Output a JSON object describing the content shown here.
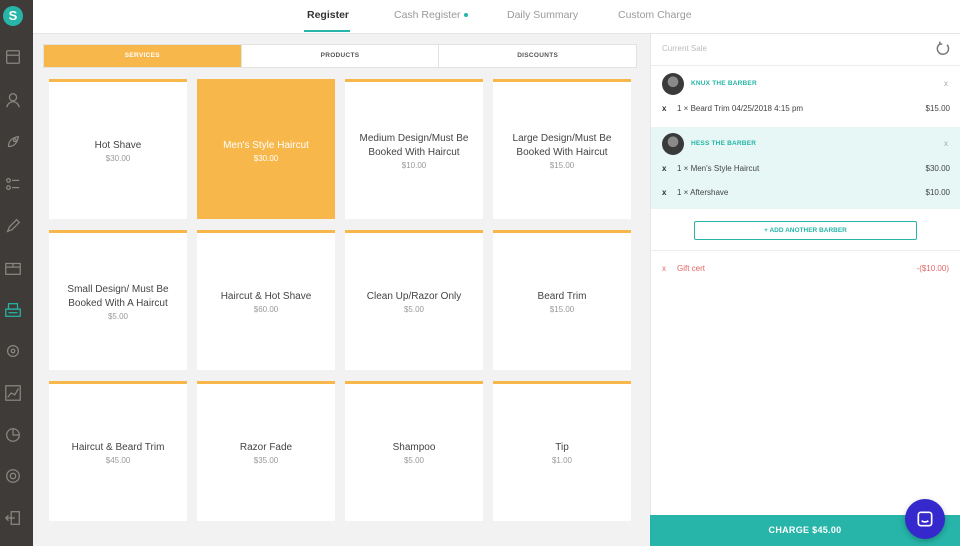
{
  "sidebar": {
    "logo": "S",
    "icons": [
      "register-icon",
      "customer-icon",
      "launch-icon",
      "list-icon",
      "edit-icon",
      "inventory-icon",
      "cash-register-icon",
      "settings-icon",
      "reports-icon",
      "analytics-icon",
      "support-icon",
      "logout-icon"
    ]
  },
  "topnav": {
    "tabs": [
      {
        "label": "Register",
        "active": true
      },
      {
        "label": "Cash Register",
        "active": false,
        "indicator": true
      },
      {
        "label": "Daily Summary",
        "active": false
      },
      {
        "label": "Custom Charge",
        "active": false
      }
    ]
  },
  "segments": [
    {
      "label": "SERVICES",
      "active": true
    },
    {
      "label": "PRODUCTS",
      "active": false
    },
    {
      "label": "DISCOUNTS",
      "active": false
    }
  ],
  "services": [
    {
      "name": "Hot Shave",
      "price": "$30.00",
      "selected": false
    },
    {
      "name": "Men's Style Haircut",
      "price": "$30.00",
      "selected": true
    },
    {
      "name": "Medium Design/Must Be Booked With Haircut",
      "price": "$10.00",
      "selected": false
    },
    {
      "name": "Large Design/Must Be Booked With Haircut",
      "price": "$15.00",
      "selected": false
    },
    {
      "name": "Small Design/ Must Be Booked With A Haircut",
      "price": "$5.00",
      "selected": false
    },
    {
      "name": "Haircut & Hot Shave",
      "price": "$60.00",
      "selected": false
    },
    {
      "name": "Clean Up/Razor Only",
      "price": "$5.00",
      "selected": false
    },
    {
      "name": "Beard Trim",
      "price": "$15.00",
      "selected": false
    },
    {
      "name": "Haircut & Beard Trim",
      "price": "$45.00",
      "selected": false
    },
    {
      "name": "Razor Fade",
      "price": "$35.00",
      "selected": false
    },
    {
      "name": "Shampoo",
      "price": "$5.00",
      "selected": false
    },
    {
      "name": "Tip",
      "price": "$1.00",
      "selected": false
    }
  ],
  "current_sale": {
    "title": "Current Sale",
    "barbers": [
      {
        "name": "KNUX THE BARBER",
        "remove": "x",
        "items": [
          {
            "remove": "x",
            "desc": "1 × Beard Trim 04/25/2018 4:15 pm",
            "price": "$15.00"
          }
        ]
      },
      {
        "name": "HESS THE BARBER",
        "remove": "x",
        "items": [
          {
            "remove": "x",
            "desc": "1 × Men's Style Haircut",
            "price": "$30.00"
          },
          {
            "remove": "x",
            "desc": "1 × Aftershave",
            "price": "$10.00"
          }
        ]
      }
    ],
    "add_barber_label": "+ ADD ANOTHER BARBER",
    "gift": {
      "remove": "x",
      "label": "Gift cert",
      "amount": "-($10.00)"
    },
    "charge_label": "CHARGE  $45.00"
  },
  "colors": {
    "accent": "#26b5a8",
    "tile": "#f8b74b",
    "sidebar": "#3e3b38",
    "chat": "#3528cc",
    "negative": "#e06666"
  }
}
